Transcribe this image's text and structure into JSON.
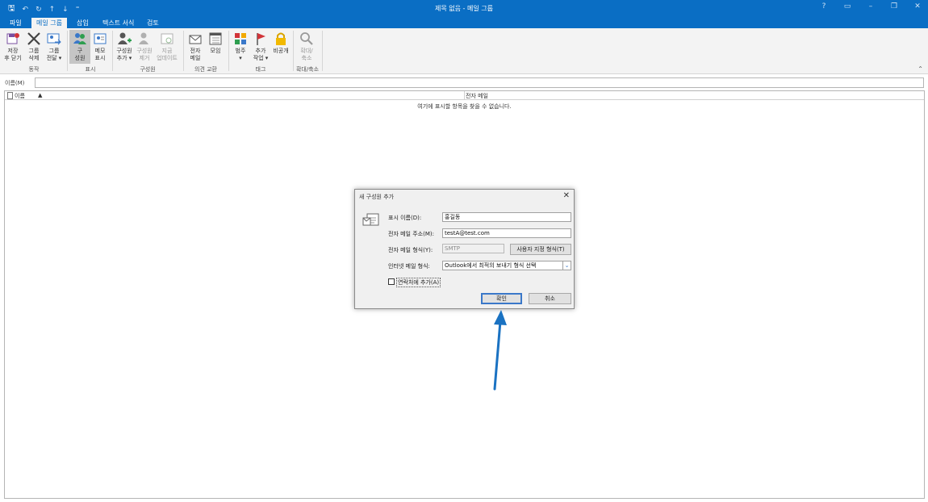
{
  "titlebar": {
    "title": "제목 없음 - 메일 그룹",
    "quick_access": [
      "save",
      "undo",
      "redo",
      "up",
      "down",
      "customize"
    ],
    "controls": [
      "?",
      "ribbon-display",
      "minimize",
      "restore",
      "close"
    ],
    "accent": "#0a6ec4"
  },
  "tabs": [
    {
      "label": "파일"
    },
    {
      "label": "메일 그룹"
    },
    {
      "label": "삽입"
    },
    {
      "label": "텍스트 서식"
    },
    {
      "label": "검토"
    }
  ],
  "ribbon": {
    "buttons": {
      "save_close": "저장\n후 닫기",
      "delete_group": "그룹\n삭제",
      "forward_group": "그룹\n전달 ▾",
      "members": "구\n성원",
      "notes": "메모\n표시",
      "add_members": "구성원\n추가 ▾",
      "remove_members": "구성원\n제거",
      "update_now": "지금\n업데이트",
      "email": "전자\n메일",
      "meeting": "모임",
      "categorize": "범주\n▾",
      "follow_up": "추가\n작업 ▾",
      "private": "비공개",
      "zoom": "확대/\n축소"
    },
    "groups": {
      "actions": "동작",
      "show": "표시",
      "members": "구성원",
      "communicate": "의견 교환",
      "tags": "태그",
      "zoom": "확대/축소"
    }
  },
  "name_field": {
    "label": "이름(M)",
    "value": ""
  },
  "list": {
    "col_name": "이름",
    "col_email": "전자 메일",
    "empty_message": "여기에 표시할 항목을 찾을 수 없습니다."
  },
  "dialog": {
    "title": "새 구성원 추가",
    "display_name_label": "표시 이름(D):",
    "display_name_value": "홍길동",
    "email_label": "전자 메일 주소(M):",
    "email_value": "testA@test.com",
    "email_type_label": "전자 메일 형식(Y):",
    "email_type_value": "SMTP",
    "custom_type_button": "사용자 지정 형식(T)",
    "internet_format_label": "인터넷 메일 형식:",
    "internet_format_value": "Outlook에서 최적의 보내기 형식 선택",
    "add_contacts_label": "연락처에 추가(A)",
    "ok_button": "확인",
    "cancel_button": "취소"
  },
  "annotation": {
    "arrow_color": "#1a72c2"
  }
}
